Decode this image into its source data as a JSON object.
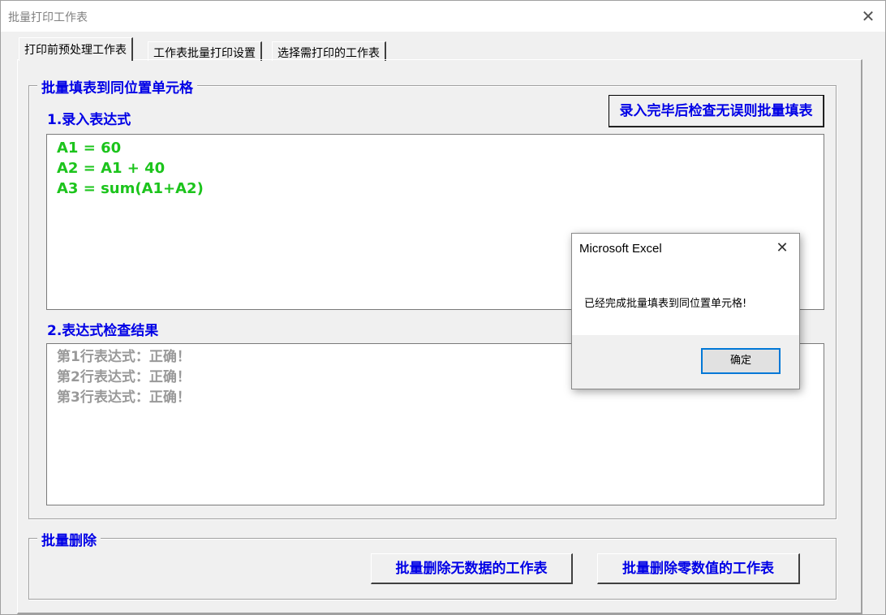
{
  "window": {
    "title": "批量打印工作表"
  },
  "tabs": [
    {
      "label": "打印前预处理工作表"
    },
    {
      "label": "工作表批量打印设置"
    },
    {
      "label": "选择需打印的工作表"
    }
  ],
  "fill_group": {
    "legend": "批量填表到同位置单元格",
    "step1_label": "1.录入表达式",
    "fill_button": "录入完毕后检查无误则批量填表",
    "expressions": [
      "A1 = 60",
      "A2 = A1 + 40",
      "A3 = sum(A1+A2)"
    ],
    "step2_label": "2.表达式检查结果",
    "results": [
      "第1行表达式：正确！",
      "第2行表达式：正确！",
      "第3行表达式：正确！"
    ]
  },
  "delete_group": {
    "legend": "批量删除",
    "delete_empty_button": "批量删除无数据的工作表",
    "delete_zero_button": "批量删除零数值的工作表"
  },
  "dialog": {
    "title": "Microsoft Excel",
    "message": "已经完成批量填表到同位置单元格!",
    "ok_label": "确定"
  },
  "colors": {
    "accent_blue": "#0000e6",
    "expression_green": "#1cc41c",
    "result_gray": "#999999",
    "focus_blue": "#0078d7"
  }
}
